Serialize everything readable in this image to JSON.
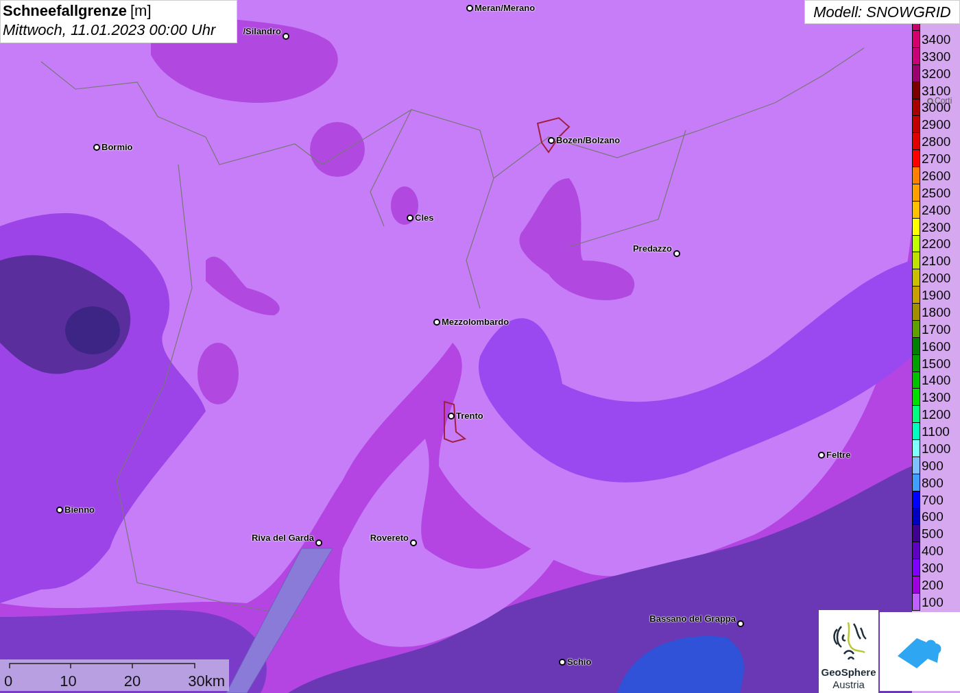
{
  "header": {
    "title": "Schneefallgrenze",
    "unit": "[m]",
    "subtitle": "Mittwoch, 11.01.2023 00:00 Uhr"
  },
  "model_label": "Modell: SNOWGRID",
  "cities": [
    {
      "name": "Meran/Merano",
      "kind": "city"
    },
    {
      "name": "/Silandro",
      "kind": "city"
    },
    {
      "name": "Bormio",
      "kind": "city"
    },
    {
      "name": "Bozen/Bolzano",
      "kind": "city"
    },
    {
      "name": "Corti",
      "kind": "faded"
    },
    {
      "name": "Cles",
      "kind": "city"
    },
    {
      "name": "Predazzo",
      "kind": "city"
    },
    {
      "name": "Mezzolombardo",
      "kind": "city"
    },
    {
      "name": "Trento",
      "kind": "city"
    },
    {
      "name": "Feltre",
      "kind": "city"
    },
    {
      "name": "Bienno",
      "kind": "city"
    },
    {
      "name": "Riva del Garda",
      "kind": "city"
    },
    {
      "name": "Rovereto",
      "kind": "city"
    },
    {
      "name": "Bassano del Grappa",
      "kind": "city"
    },
    {
      "name": "Schio",
      "kind": "city"
    }
  ],
  "legend": [
    {
      "label": "3400",
      "color": "#d4006e"
    },
    {
      "label": "3300",
      "color": "#c8007a"
    },
    {
      "label": "3200",
      "color": "#9a0070"
    },
    {
      "label": "3100",
      "color": "#7a0000"
    },
    {
      "label": "3000",
      "color": "#a80000"
    },
    {
      "label": "2900",
      "color": "#c00000"
    },
    {
      "label": "2800",
      "color": "#e00000"
    },
    {
      "label": "2700",
      "color": "#ff0000"
    },
    {
      "label": "2600",
      "color": "#ff8000"
    },
    {
      "label": "2500",
      "color": "#ffa000"
    },
    {
      "label": "2400",
      "color": "#ffc000"
    },
    {
      "label": "2300",
      "color": "#ffff00"
    },
    {
      "label": "2200",
      "color": "#c0ff00"
    },
    {
      "label": "2100",
      "color": "#c0e000"
    },
    {
      "label": "2000",
      "color": "#c8c000"
    },
    {
      "label": "1900",
      "color": "#c8a000"
    },
    {
      "label": "1800",
      "color": "#a09000"
    },
    {
      "label": "1700",
      "color": "#60a000"
    },
    {
      "label": "1600",
      "color": "#008000"
    },
    {
      "label": "1500",
      "color": "#00a000"
    },
    {
      "label": "1400",
      "color": "#00c000"
    },
    {
      "label": "1300",
      "color": "#00e000"
    },
    {
      "label": "1200",
      "color": "#00ff80"
    },
    {
      "label": "1100",
      "color": "#00ffc0"
    },
    {
      "label": "1000",
      "color": "#80ffff"
    },
    {
      "label": "900",
      "color": "#80c0ff"
    },
    {
      "label": "800",
      "color": "#40a0ff"
    },
    {
      "label": "700",
      "color": "#0000ff"
    },
    {
      "label": "600",
      "color": "#0000c0"
    },
    {
      "label": "500",
      "color": "#400090"
    },
    {
      "label": "400",
      "color": "#6000c0"
    },
    {
      "label": "300",
      "color": "#8000ff"
    },
    {
      "label": "200",
      "color": "#a000e0"
    },
    {
      "label": "100",
      "color": "#c060ff"
    }
  ],
  "scale_bar": {
    "ticks": [
      "0",
      "10",
      "20",
      "30km"
    ]
  },
  "logo": {
    "name": "GeoSphere",
    "subname": "Austria"
  }
}
